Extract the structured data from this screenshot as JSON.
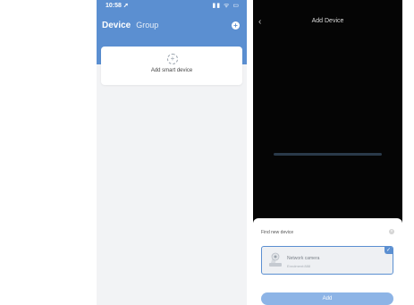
{
  "left_phone": {
    "status_time": "10:58 ➚",
    "status_icons": "▮▮ ᯤ ▭",
    "tabs": {
      "device": "Device",
      "group": "Group"
    },
    "plus_icon": "+",
    "add_card": {
      "label": "Add smart device",
      "icon": "plus-dashed-icon"
    },
    "colors": {
      "header": "#5b8fd1",
      "background": "#f2f3f5"
    }
  },
  "right_phone": {
    "title": "Add Device",
    "back_icon": "‹",
    "sheet": {
      "title": "Find new device",
      "close_icon": "×",
      "device": {
        "name": "Network camera",
        "sub": "Enrolment:888"
      },
      "check_icon": "✓",
      "add_button": "Add"
    },
    "colors": {
      "accent": "#5b8fd1",
      "background": "#050505"
    }
  }
}
